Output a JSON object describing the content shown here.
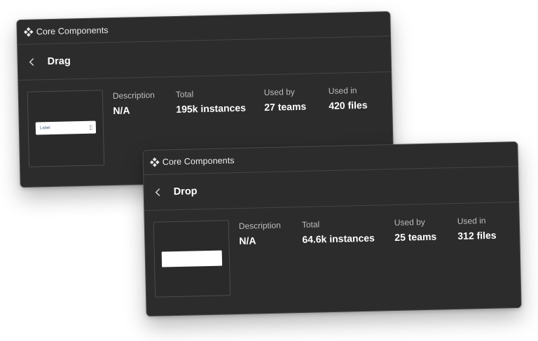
{
  "cards": [
    {
      "library": "Core Components",
      "component": "Drag",
      "thumbnail_label": "Label",
      "stats": {
        "description": {
          "label": "Description",
          "value": "N/A"
        },
        "total": {
          "label": "Total",
          "value": "195k instances"
        },
        "used_by": {
          "label": "Used by",
          "value": "27 teams"
        },
        "used_in": {
          "label": "Used in",
          "value": "420 files"
        }
      },
      "icons": [
        "component-icon",
        "chevron-left-icon",
        "drag-handle-icon"
      ]
    },
    {
      "library": "Core Components",
      "component": "Drop",
      "stats": {
        "description": {
          "label": "Description",
          "value": "N/A"
        },
        "total": {
          "label": "Total",
          "value": "64.6k instances"
        },
        "used_by": {
          "label": "Used by",
          "value": "25 teams"
        },
        "used_in": {
          "label": "Used in",
          "value": "312 files"
        }
      },
      "icons": [
        "component-icon",
        "chevron-left-icon"
      ]
    }
  ],
  "colors": {
    "panel_bg": "#2c2c2c",
    "divider": "#444444",
    "text_primary": "#ffffff",
    "text_secondary": "#bdbdbd"
  }
}
